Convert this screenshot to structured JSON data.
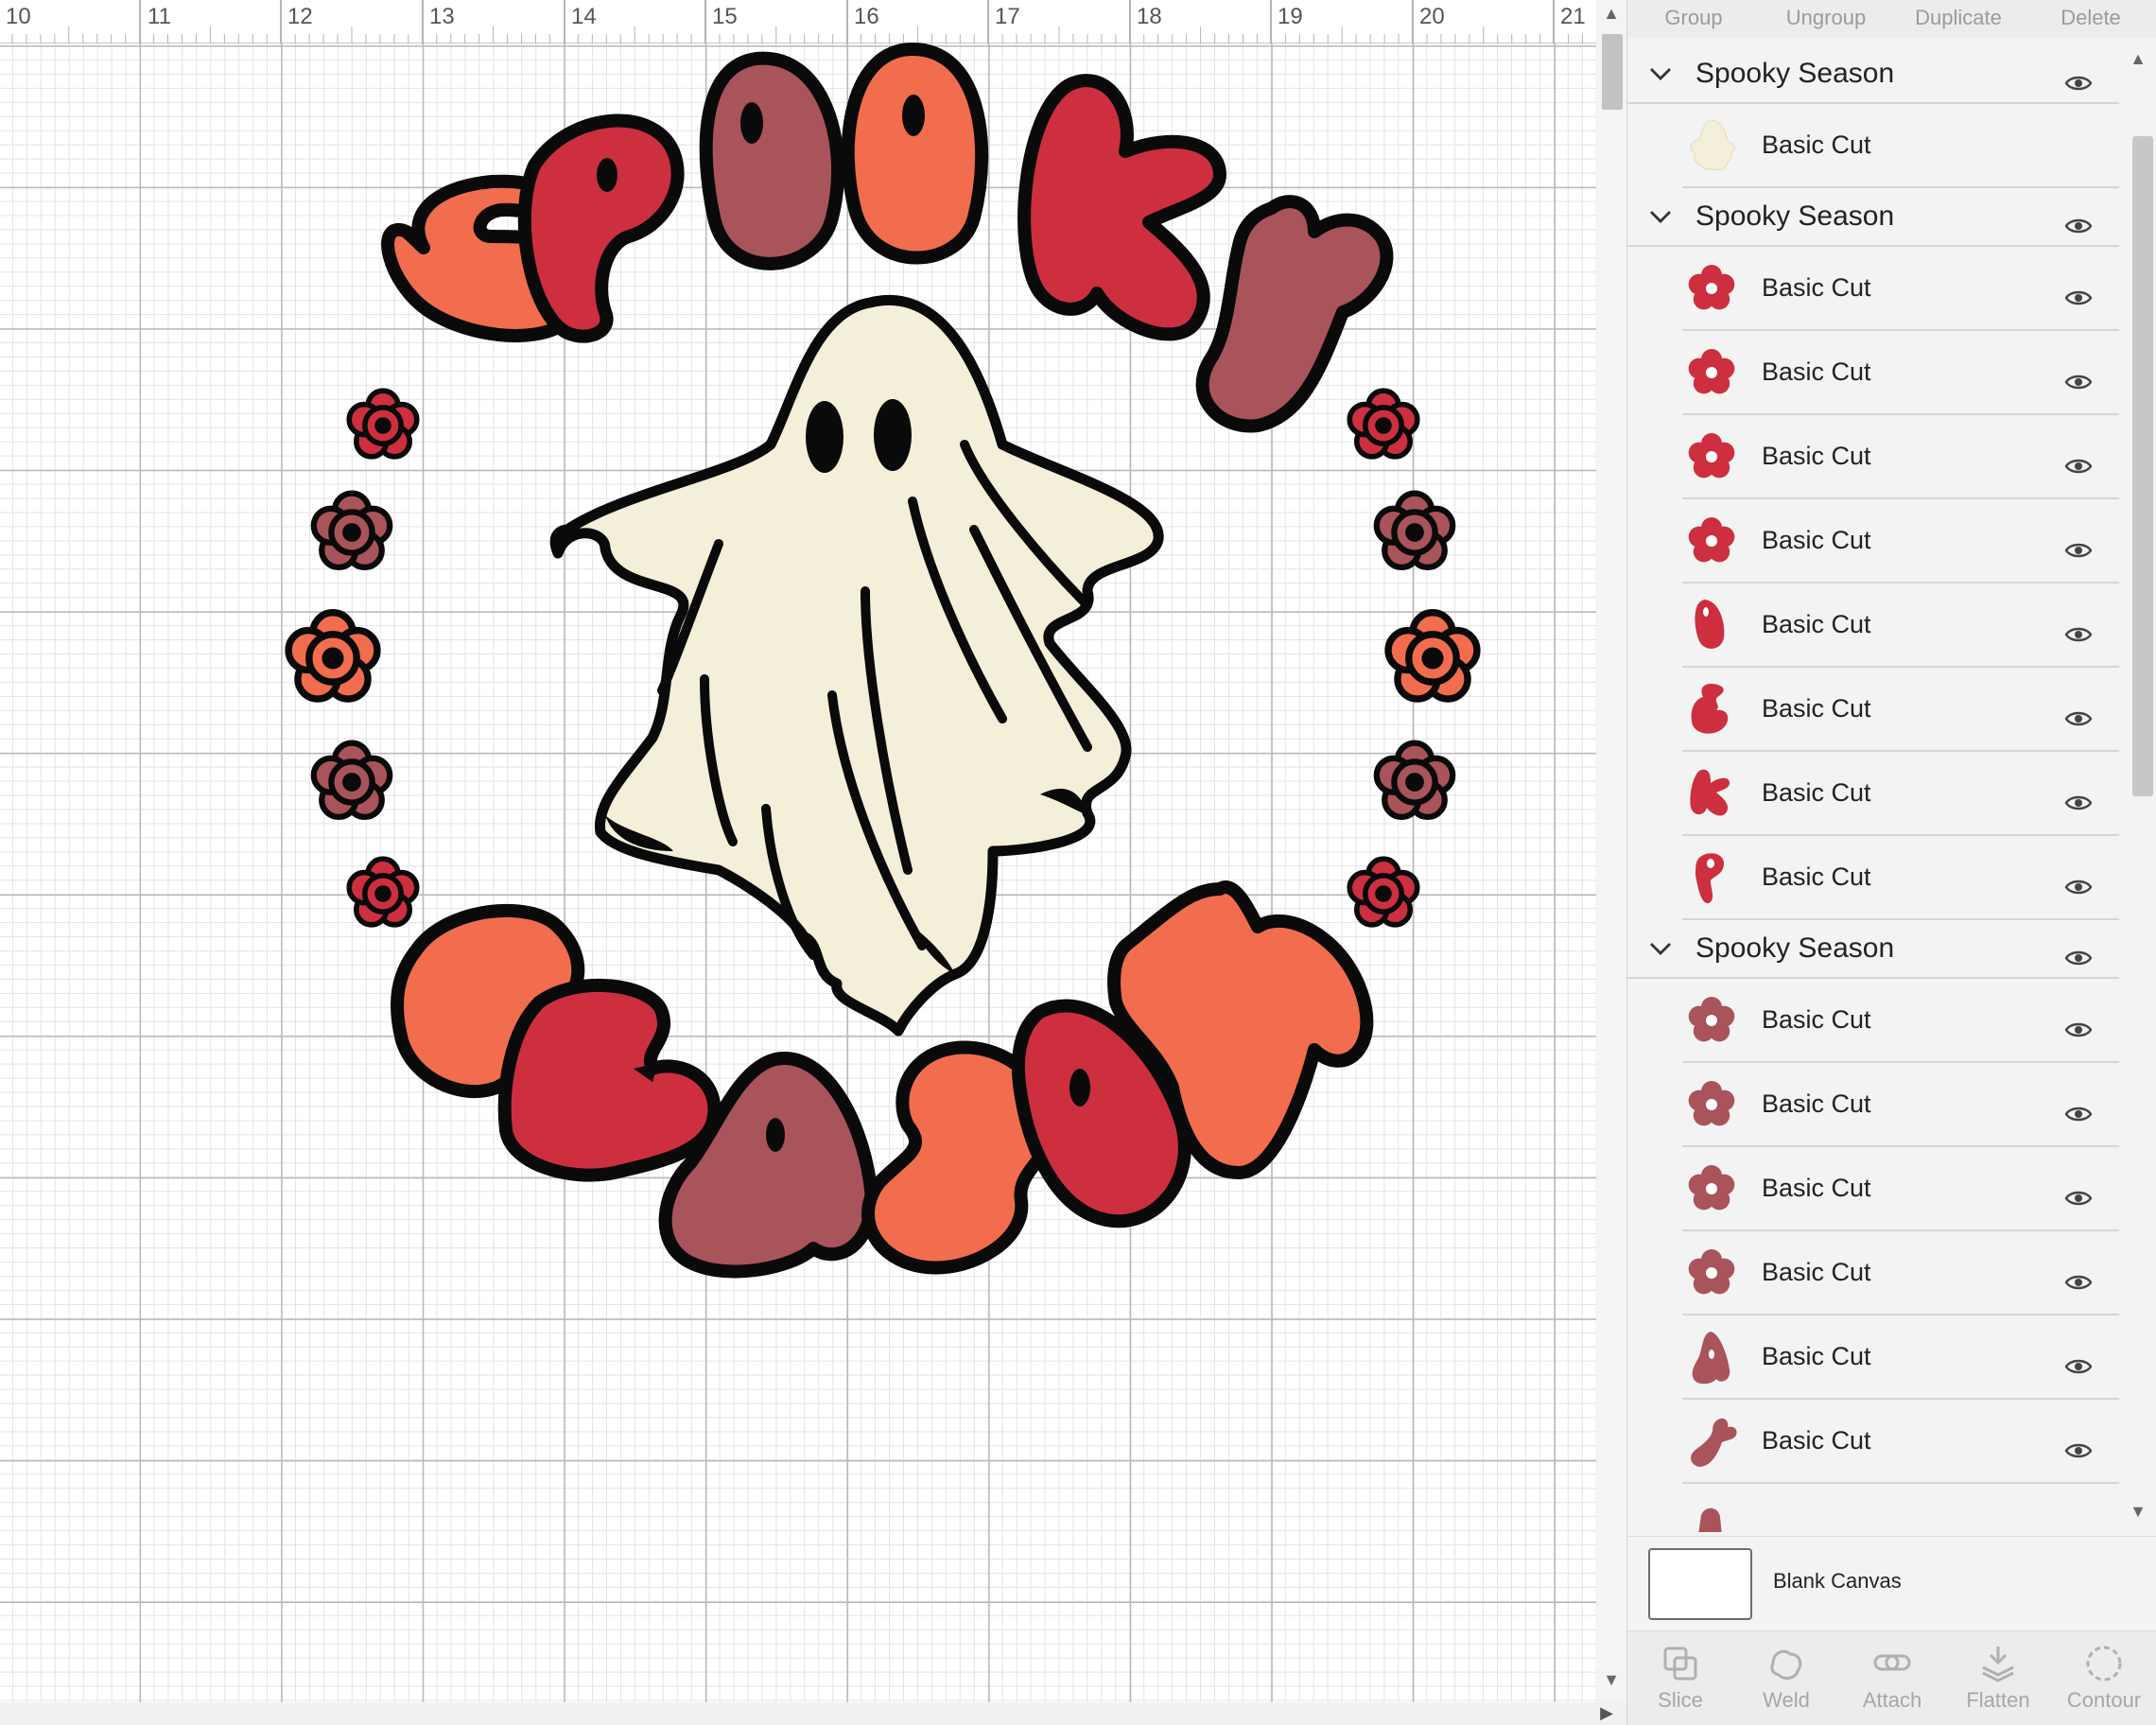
{
  "ruler": {
    "ticks": [
      "10",
      "11",
      "12",
      "13",
      "14",
      "15",
      "16",
      "17",
      "18",
      "19",
      "20",
      "21"
    ]
  },
  "toolbar": {
    "group": "Group",
    "ungroup": "Ungroup",
    "duplicate": "Duplicate",
    "delete": "Delete"
  },
  "layers": [
    {
      "group": "Spooky Season",
      "rows": [
        {
          "label": "Basic Cut",
          "icon": "ghost-shape-icon",
          "color": "#f3efd9"
        }
      ]
    },
    {
      "group": "Spooky Season",
      "rows": [
        {
          "label": "Basic Cut",
          "icon": "flower-icon",
          "color": "#cd2f3f"
        },
        {
          "label": "Basic Cut",
          "icon": "flower-icon",
          "color": "#cd2f3f"
        },
        {
          "label": "Basic Cut",
          "icon": "flower-icon",
          "color": "#cd2f3f"
        },
        {
          "label": "Basic Cut",
          "icon": "flower-icon",
          "color": "#cd2f3f"
        },
        {
          "label": "Basic Cut",
          "icon": "letter-o-icon",
          "color": "#cd2f3f"
        },
        {
          "label": "Basic Cut",
          "icon": "letter-e-icon",
          "color": "#cd2f3f"
        },
        {
          "label": "Basic Cut",
          "icon": "letter-k-icon",
          "color": "#cd2f3f"
        },
        {
          "label": "Basic Cut",
          "icon": "letter-p-icon",
          "color": "#cd2f3f"
        }
      ]
    },
    {
      "group": "Spooky Season",
      "rows": [
        {
          "label": "Basic Cut",
          "icon": "flower-icon",
          "color": "#a9545a"
        },
        {
          "label": "Basic Cut",
          "icon": "flower-icon",
          "color": "#a9545a"
        },
        {
          "label": "Basic Cut",
          "icon": "flower-icon",
          "color": "#a9545a"
        },
        {
          "label": "Basic Cut",
          "icon": "flower-icon",
          "color": "#a9545a"
        },
        {
          "label": "Basic Cut",
          "icon": "letter-a-icon",
          "color": "#a9545a"
        },
        {
          "label": "Basic Cut",
          "icon": "letter-y-icon",
          "color": "#a9545a"
        }
      ]
    }
  ],
  "blank_canvas": {
    "label": "Blank Canvas"
  },
  "bottom_tools": {
    "slice": "Slice",
    "weld": "Weld",
    "attach": "Attach",
    "flatten": "Flatten",
    "contour": "Contour"
  },
  "colors": {
    "red": "#cd2f3f",
    "rose": "#a9545a",
    "orange": "#f16d4e",
    "cream": "#f3efd9",
    "outline": "#0a0a0a"
  }
}
